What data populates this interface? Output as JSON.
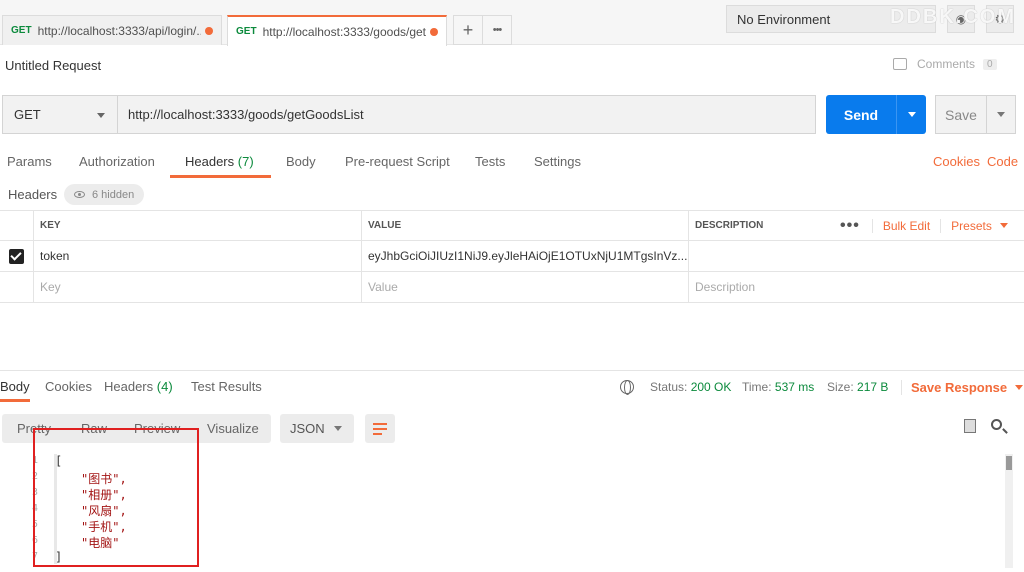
{
  "tabs": [
    {
      "method": "GET",
      "url": "http://localhost:3333/api/login/..."
    },
    {
      "method": "GET",
      "url": "http://localhost:3333/goods/get..."
    }
  ],
  "tab_actions": {
    "add": "+",
    "more": "•••"
  },
  "environment": {
    "selected": "No Environment"
  },
  "watermark": "DDBK.COM",
  "request": {
    "title": "Untitled Request",
    "comments_label": "Comments",
    "comments_count": "0",
    "method": "GET",
    "url": "http://localhost:3333/goods/getGoodsList",
    "send_label": "Send",
    "save_label": "Save"
  },
  "request_tabs": {
    "params": "Params",
    "authorization": "Authorization",
    "headers": "Headers",
    "headers_count": "(7)",
    "body": "Body",
    "prerequest": "Pre-request Script",
    "tests": "Tests",
    "settings": "Settings",
    "cookies": "Cookies",
    "code": "Code"
  },
  "headers_section": {
    "label": "Headers",
    "hidden_label": "6 hidden",
    "columns": {
      "key": "KEY",
      "value": "VALUE",
      "description": "DESCRIPTION"
    },
    "bulk_edit": "Bulk Edit",
    "presets": "Presets",
    "rows": [
      {
        "checked": true,
        "key": "token",
        "value": "eyJhbGciOiJIUzI1NiJ9.eyJleHAiOjE1OTUxNjU1MTgsInVz..."
      }
    ],
    "placeholders": {
      "key": "Key",
      "value": "Value",
      "description": "Description"
    }
  },
  "response": {
    "tabs": {
      "body": "Body",
      "cookies": "Cookies",
      "headers": "Headers",
      "headers_count": "(4)",
      "test_results": "Test Results"
    },
    "status_label": "Status:",
    "status_value": "200 OK",
    "time_label": "Time:",
    "time_value": "537 ms",
    "size_label": "Size:",
    "size_value": "217 B",
    "save_response": "Save Response",
    "view_modes": {
      "pretty": "Pretty",
      "raw": "Raw",
      "preview": "Preview",
      "visualize": "Visualize"
    },
    "format": "JSON",
    "line_numbers": [
      "1",
      "2",
      "3",
      "4",
      "5",
      "6",
      "7"
    ],
    "body_lines": [
      "[",
      "\"图书\",",
      "\"相册\",",
      "\"风扇\",",
      "\"手机\",",
      "\"电脑\"",
      "]"
    ]
  }
}
